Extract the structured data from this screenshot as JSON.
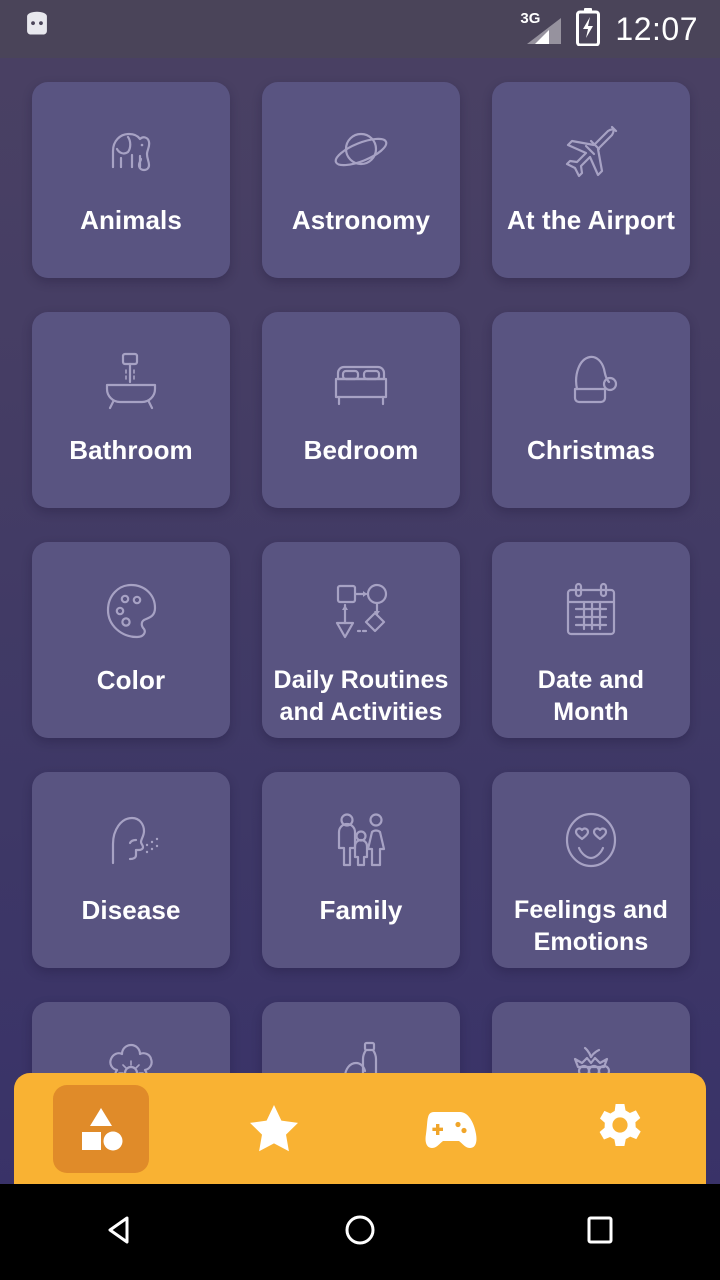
{
  "status_bar": {
    "notification_icon": "android-robot-icon",
    "network_type": "3G",
    "signal_icon": "signal-bars-icon",
    "battery_icon": "battery-charging-icon",
    "time": "12:07"
  },
  "grid": {
    "cards": [
      {
        "label": "Animals",
        "icon": "elephant-icon",
        "lines": 1
      },
      {
        "label": "Astronomy",
        "icon": "planet-icon",
        "lines": 1
      },
      {
        "label": "At the Airport",
        "icon": "airplane-icon",
        "lines": 1
      },
      {
        "label": "Bathroom",
        "icon": "bathtub-icon",
        "lines": 1
      },
      {
        "label": "Bedroom",
        "icon": "bed-icon",
        "lines": 1
      },
      {
        "label": "Christmas",
        "icon": "santa-hat-icon",
        "lines": 1
      },
      {
        "label": "Color",
        "icon": "palette-icon",
        "lines": 1
      },
      {
        "label": "Daily Routines and Activities",
        "icon": "flowchart-icon",
        "lines": 2
      },
      {
        "label": "Date and Month",
        "icon": "calendar-icon",
        "lines": 2
      },
      {
        "label": "Disease",
        "icon": "coughing-head-icon",
        "lines": 1
      },
      {
        "label": "Family",
        "icon": "family-icon",
        "lines": 1
      },
      {
        "label": "Feelings and Emotions",
        "icon": "heart-eyes-face-icon",
        "lines": 2
      },
      {
        "label": "",
        "icon": "flower-icon",
        "lines": 1
      },
      {
        "label": "",
        "icon": "picnic-basket-icon",
        "lines": 1
      },
      {
        "label": "",
        "icon": "berry-icon",
        "lines": 1
      }
    ]
  },
  "bottom_nav": {
    "items": [
      {
        "name": "categories",
        "icon": "shapes-icon",
        "selected": true
      },
      {
        "name": "favorites",
        "icon": "star-icon",
        "selected": false
      },
      {
        "name": "games",
        "icon": "gamepad-icon",
        "selected": false
      },
      {
        "name": "settings",
        "icon": "gear-icon",
        "selected": false
      }
    ]
  },
  "system_nav": {
    "back": "back-triangle-icon",
    "home": "home-circle-icon",
    "recents": "recents-square-icon"
  },
  "colors": {
    "background_top": "#4a4163",
    "background_bottom": "#383169",
    "card": "#595481",
    "card_icon_stroke": "#a7a2c4",
    "accent_orange": "#f9b233",
    "accent_orange_dark": "#e08b29",
    "status_bar": "#4a4459",
    "text": "#ffffff"
  }
}
